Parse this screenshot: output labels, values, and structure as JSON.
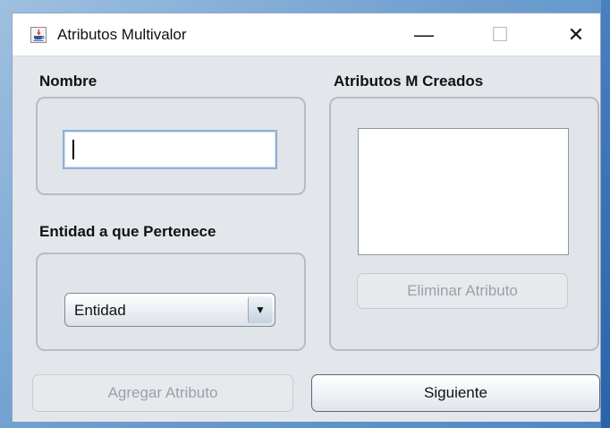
{
  "window": {
    "title": "Atributos Multivalor",
    "controls": {
      "minimize": "—",
      "maximize": "☐",
      "close": "✕"
    }
  },
  "nombre": {
    "label": "Nombre",
    "value": ""
  },
  "entidad": {
    "label": "Entidad a que Pertenece",
    "selected": "Entidad",
    "arrow": "▼"
  },
  "creados": {
    "label": "Atributos M Creados",
    "items": [],
    "remove_label": "Eliminar Atributo"
  },
  "footer": {
    "add_label": "Agregar Atributo",
    "next_label": "Siguiente"
  },
  "icons": {
    "app": "java-app-icon"
  }
}
